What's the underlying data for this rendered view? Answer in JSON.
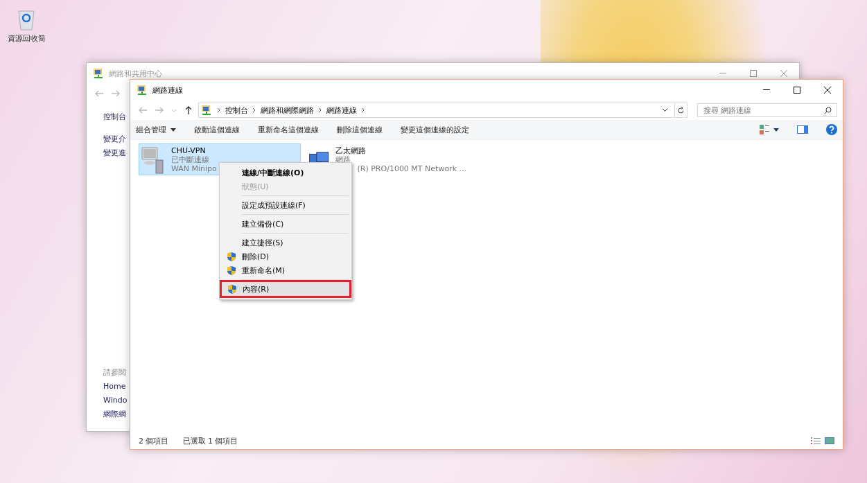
{
  "desktop": {
    "icon_label": "資源回收筒"
  },
  "back_window": {
    "title": "網路和共用中心",
    "sidebar_top": [
      "控制台",
      "變更介",
      "變更進"
    ],
    "see_also_heading": "請參閱",
    "see_also": [
      "Home",
      "Windo",
      "網際網"
    ]
  },
  "window": {
    "title": "網路連線",
    "breadcrumb": [
      "控制台",
      "網路和網際網路",
      "網路連線"
    ],
    "search": {
      "placeholder": "搜尋 網路連線"
    },
    "commands": [
      {
        "label": "組合管理",
        "dropdown": true
      },
      {
        "label": "啟動這個連線",
        "dropdown": false
      },
      {
        "label": "重新命名這個連線",
        "dropdown": false
      },
      {
        "label": "刪除這個連線",
        "dropdown": false
      },
      {
        "label": "變更這個連線的設定",
        "dropdown": false
      }
    ],
    "connections": [
      {
        "name": "CHU-VPN",
        "status": "已中斷連線",
        "device": "WAN Minipo",
        "selected": true,
        "kind": "vpn"
      },
      {
        "name": "乙太網路",
        "status": "網路",
        "device": "(R) PRO/1000 MT Network ...",
        "selected": false,
        "kind": "ethernet"
      }
    ],
    "status_bar": [
      "2 個項目",
      "已選取 1 個項目"
    ]
  },
  "context_menu": [
    {
      "kind": "item",
      "label": "連線/中斷連線(O)",
      "bold": true,
      "disabled": false,
      "shield": false,
      "selected": false
    },
    {
      "kind": "item",
      "label": "狀態(U)",
      "bold": false,
      "disabled": true,
      "shield": false,
      "selected": false
    },
    {
      "kind": "separator"
    },
    {
      "kind": "item",
      "label": "設定成預設連線(F)",
      "bold": false,
      "disabled": false,
      "shield": false,
      "selected": false
    },
    {
      "kind": "separator"
    },
    {
      "kind": "item",
      "label": "建立備份(C)",
      "bold": false,
      "disabled": false,
      "shield": false,
      "selected": false
    },
    {
      "kind": "separator"
    },
    {
      "kind": "item",
      "label": "建立捷徑(S)",
      "bold": false,
      "disabled": false,
      "shield": false,
      "selected": false
    },
    {
      "kind": "item",
      "label": "刪除(D)",
      "bold": false,
      "disabled": false,
      "shield": true,
      "selected": false
    },
    {
      "kind": "item",
      "label": "重新命名(M)",
      "bold": false,
      "disabled": false,
      "shield": true,
      "selected": false
    },
    {
      "kind": "separator"
    },
    {
      "kind": "item",
      "label": "內容(R)",
      "bold": false,
      "disabled": false,
      "shield": true,
      "selected": true
    }
  ]
}
